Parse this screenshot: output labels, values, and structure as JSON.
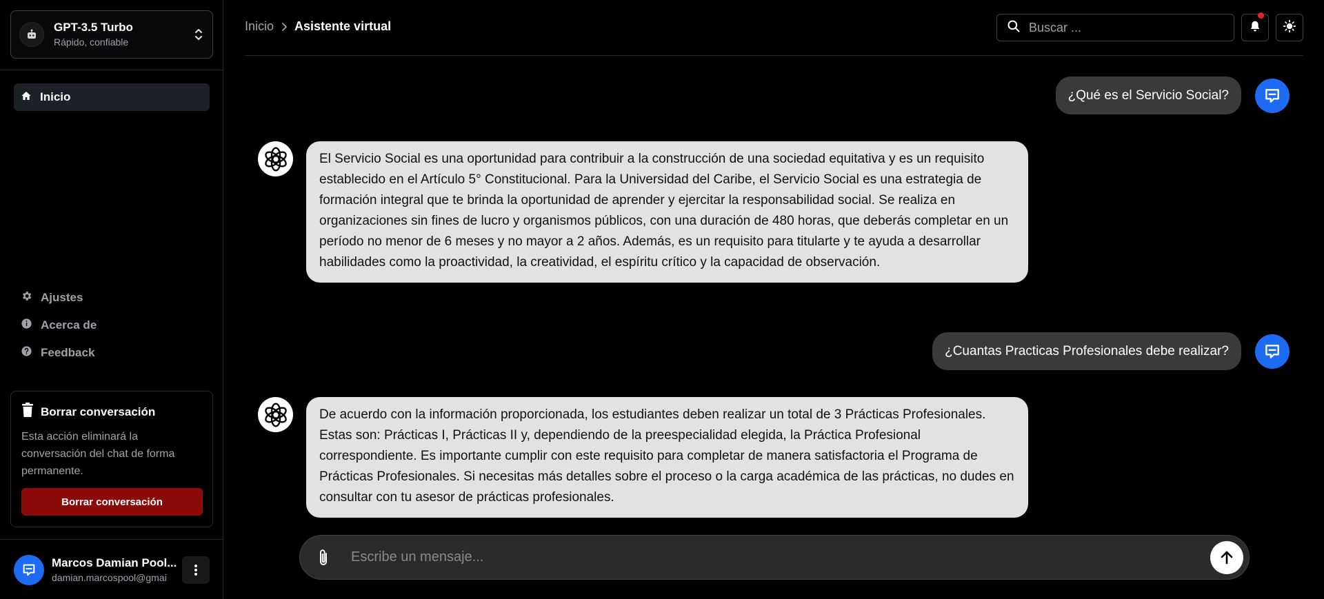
{
  "sidebar": {
    "model": {
      "name": "GPT-3.5 Turbo",
      "subtitle": "Rápido, confiable",
      "icon": "bot-icon"
    },
    "nav_home": {
      "label": "Inicio",
      "icon": "home-icon"
    },
    "nav_items": [
      {
        "label": "Ajustes",
        "icon": "gear-icon"
      },
      {
        "label": "Acerca de",
        "icon": "info-icon"
      },
      {
        "label": "Feedback",
        "icon": "help-icon"
      }
    ],
    "delete_card": {
      "title": "Borrar conversación",
      "description": "Esta acción eliminará la conversación del chat de forma permanente.",
      "button_label": "Borrar conversación"
    },
    "user": {
      "name": "Marcos Damian Pool...",
      "email": "damian.marcospool@gmai"
    }
  },
  "header": {
    "breadcrumb_home": "Inicio",
    "breadcrumb_current": "Asistente virtual",
    "search_placeholder": "Buscar ..."
  },
  "messages": [
    {
      "role": "user",
      "text": "¿Qué es el Servicio Social?"
    },
    {
      "role": "assistant",
      "text": "El Servicio Social es una oportunidad para contribuir a la construcción de una sociedad equitativa y es un requisito establecido en el Artículo 5° Constitucional. Para la Universidad del Caribe, el Servicio Social es una estrategia de formación integral que te brinda la oportunidad de aprender y ejercitar la responsabilidad social. Se realiza en organizaciones sin fines de lucro y organismos públicos, con una duración de 480 horas, que deberás completar en un período no menor de 6 meses y no mayor a 2 años. Además, es un requisito para titularte y te ayuda a desarrollar habilidades como la proactividad, la creatividad, el espíritu crítico y la capacidad de observación."
    },
    {
      "role": "user",
      "text": "¿Cuantas Practicas Profesionales debe realizar?"
    },
    {
      "role": "assistant",
      "text": "De acuerdo con la información proporcionada, los estudiantes deben realizar un total de 3 Prácticas Profesionales. Estas son: Prácticas I, Prácticas II y, dependiendo de la preespecialidad elegida, la Práctica Profesional correspondiente. Es importante cumplir con este requisito para completar de manera satisfactoria el Programa de Prácticas Profesionales. Si necesitas más detalles sobre el proceso o la carga académica de las prácticas, no dudes en consultar con tu asesor de prácticas profesionales."
    }
  ],
  "composer": {
    "placeholder": "Escribe un mensaje...",
    "value": ""
  },
  "colors": {
    "accent": "#1d6bf3",
    "danger": "#8b0a0a",
    "notification": "#dc2626",
    "bubble_user": "#3a3a3a",
    "bubble_bot": "#e2e2e2"
  }
}
